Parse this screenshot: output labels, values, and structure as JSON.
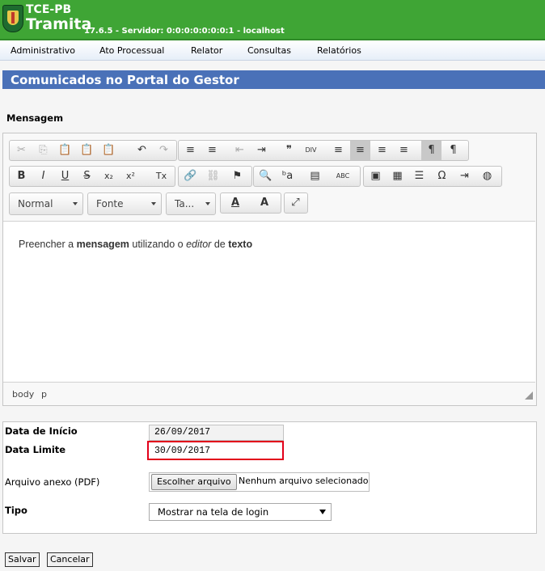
{
  "header": {
    "brand_top": "TCE-PB",
    "brand_main": "Tramita",
    "server": "17.6.5 - Servidor: 0:0:0:0:0:0:0:1 - localhost"
  },
  "menu": [
    "Administrativo",
    "Ato Processual",
    "Relator",
    "Consultas",
    "Relatórios"
  ],
  "page_title": "Comunicados no Portal do Gestor",
  "editor": {
    "label": "Mensagem",
    "combos": {
      "format": "Normal",
      "font": "Fonte",
      "size": "Ta..."
    },
    "content": {
      "t1": "Preencher a ",
      "b1": "mensagem",
      "t2": " utilizando o ",
      "i1": "editor",
      "t3": " de ",
      "b2": "texto"
    },
    "path": [
      "body",
      "p"
    ]
  },
  "icons": {
    "cut": "✂",
    "copy": "⎘",
    "paste": "📋",
    "paste_text": "📋",
    "paste_word": "📋",
    "undo": "↶",
    "redo": "↷",
    "ol": "≡",
    "ul": "≡",
    "outdent": "⇤",
    "indent": "⇥",
    "quote": "❞",
    "div": "DIV",
    "align_left": "≡",
    "align_center": "≡",
    "align_right": "≡",
    "justify": "≡",
    "ltr": "¶",
    "rtl": "¶",
    "bold": "B",
    "italic": "I",
    "underline": "U",
    "strike": "S",
    "sub": "x₂",
    "sup": "x²",
    "remove_format": "Tx",
    "link": "🔗",
    "unlink": "⛓",
    "anchor": "⚑",
    "find": "🔍",
    "replace": "ᵇa",
    "select_all": "▤",
    "spell": "ABC",
    "image": "▣",
    "table": "▦",
    "hr": "☰",
    "omega": "Ω",
    "pagebreak": "⇥",
    "iframe": "◍",
    "font_color": "A",
    "bg_color": "A",
    "maximize": "⤢"
  },
  "form": {
    "data_inicio_label": "Data de Início",
    "data_inicio_value": "26/09/2017",
    "data_limite_label": "Data Limite",
    "data_limite_value": "30/09/2017",
    "arquivo_label": "Arquivo anexo (PDF)",
    "arquivo_button": "Escolher arquivo",
    "arquivo_status": "Nenhum arquivo selecionado",
    "tipo_label": "Tipo",
    "tipo_value": "Mostrar na tela de login"
  },
  "actions": {
    "save": "Salvar",
    "cancel": "Cancelar"
  },
  "colors": {
    "header": "#3fa535",
    "title_bar": "#4a71b8",
    "highlight": "#e2001a"
  }
}
